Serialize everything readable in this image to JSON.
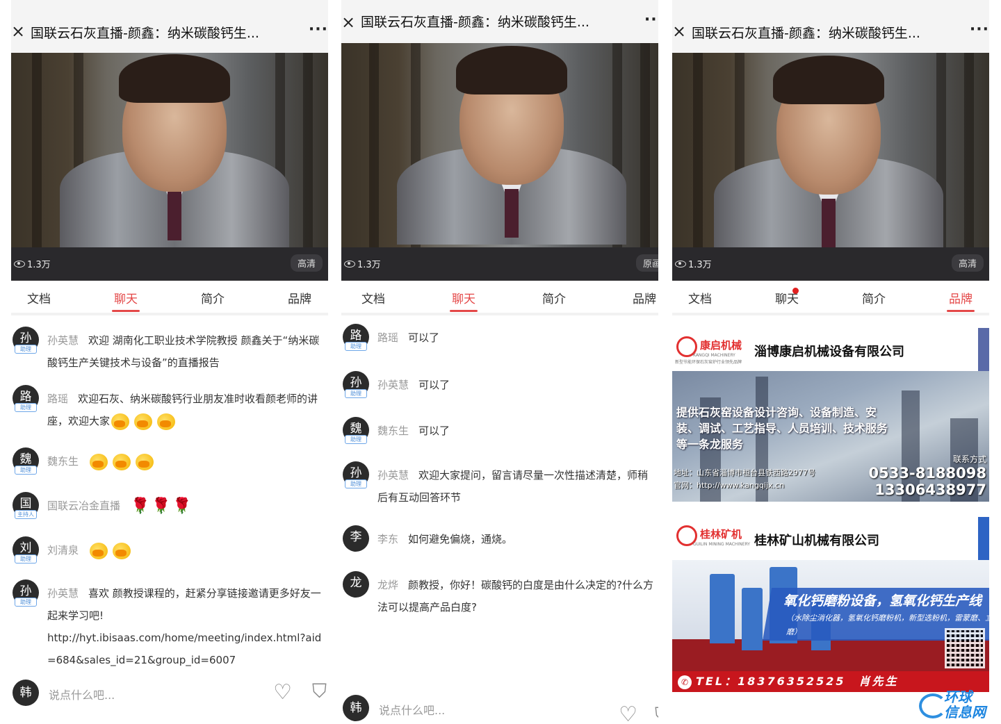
{
  "colors": {
    "accent": "#e44848",
    "badge": "#4d8ed8",
    "video_bg": "#2c2b2d"
  },
  "header": {
    "title": "国联云石灰直播-颜鑫：纳米碳酸钙生...",
    "more": "···",
    "close": "×"
  },
  "video": {
    "views": "1.3万",
    "quality_1": "高清",
    "quality_2": "原画",
    "quality_3": "高清"
  },
  "tabs": [
    "文档",
    "聊天",
    "简介",
    "品牌"
  ],
  "panel1": {
    "messages": [
      {
        "avatar": "孙",
        "badge": "助理",
        "name": "孙英慧",
        "text": "欢迎 湖南化工职业技术学院教授 颜鑫关于“纳米碳酸钙生产关键技术与设备”的直播报告"
      },
      {
        "avatar": "路",
        "badge": "助理",
        "name": "路瑶",
        "text": "欢迎石灰、纳米碳酸钙行业朋友准时收看颜老师的讲座，欢迎大家"
      },
      {
        "avatar": "魏",
        "badge": "助理",
        "name": "魏东生",
        "text": ""
      },
      {
        "avatar": "国",
        "badge": "主持人",
        "name": "国联云冶金直播",
        "text": ""
      },
      {
        "avatar": "刘",
        "badge": "助理",
        "name": "刘清泉",
        "text": ""
      },
      {
        "avatar": "孙",
        "badge": "助理",
        "name": "孙英慧",
        "text": "喜欢 颜教授课程的，赶紧分享链接邀请更多好友一起来学习吧!",
        "link": "http://hyt.ibisaas.com/home/meeting/index.html?aid=684&sales_id=21&group_id=6007"
      }
    ],
    "input": {
      "avatar": "韩",
      "placeholder": "说点什么吧..."
    }
  },
  "panel2": {
    "messages": [
      {
        "avatar": "路",
        "badge": "助理",
        "name": "路瑶",
        "text": "可以了"
      },
      {
        "avatar": "孙",
        "badge": "助理",
        "name": "孙英慧",
        "text": "可以了"
      },
      {
        "avatar": "魏",
        "badge": "助理",
        "name": "魏东生",
        "text": "可以了"
      },
      {
        "avatar": "孙",
        "badge": "助理",
        "name": "孙英慧",
        "text": "欢迎大家提问，留言请尽量一次性描述清楚，师稍后有互动回答环节"
      },
      {
        "avatar": "李",
        "badge": "",
        "name": "李东",
        "text": "如何避免偏烧，通烧。"
      },
      {
        "avatar": "龙",
        "badge": "",
        "name": "龙烨",
        "text": "颜教授，你好！碳酸钙的白度是由什么决定的?什么方法可以提高产品白度?"
      }
    ],
    "input": {
      "avatar": "韩",
      "placeholder": "说点什么吧..."
    }
  },
  "panel3": {
    "ad1": {
      "logo": "康启机械",
      "logo_en": "KANGQI MACHINERY",
      "logo_tagline": "新型节能环保石灰窑炉行业领先品牌",
      "company": "淄博康启机械设备有限公司",
      "slogan": "提供石灰窑设备设计咨询、设备制造、安装、调试、工艺指导、人员培训、技术服务等一条龙服务",
      "address": "地址：山东省淄博市桓台县铁西路2977号",
      "website": "官网：http://www.kangqijx.cn",
      "contact_label": "联系方式",
      "phone1": "0533-8188098",
      "phone2": "13306438977"
    },
    "ad2": {
      "logo": "桂林矿机",
      "logo_en": "GUILIN MINING MACHINERY",
      "company": "桂林矿山机械有限公司",
      "title": "氧化钙磨粉设备，氢氧化钙生产线",
      "subtitle": "（水除尘消化器，氢氧化钙磨粉机，新型选粉机，雷蒙磨、立磨）",
      "tel": "TEL：18376352525　肖先生"
    }
  },
  "watermark": {
    "text1": "环球",
    "text2": "信息网"
  }
}
